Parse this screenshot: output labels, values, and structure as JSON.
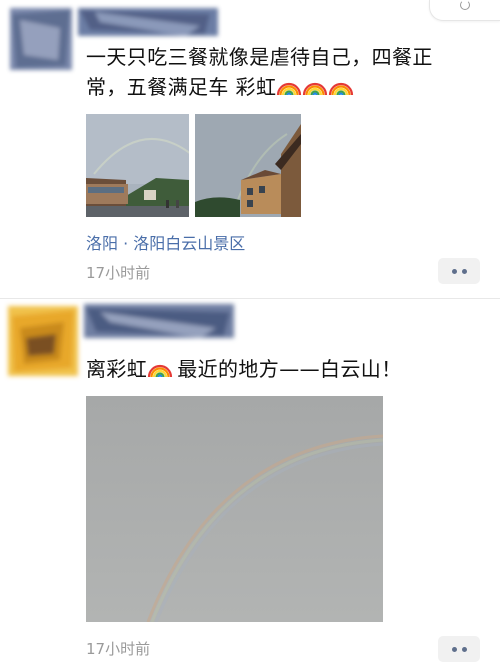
{
  "posts": [
    {
      "text_line1": "一天只吃三餐就像是虐待自己，四餐正",
      "text_line2": "常，五餐满足车 彩虹",
      "location": "洛阳 · 洛阳白云山景区",
      "time": "17小时前",
      "images": [
        "rainbow-photo-hotel",
        "rainbow-photo-building"
      ]
    },
    {
      "text_before": "离彩虹",
      "text_after": "最近的地方——白云山！",
      "time": "17小时前",
      "images": [
        "rainbow-photo-sky"
      ]
    }
  ],
  "icons": {
    "rainbow": "rainbow-emoji-icon",
    "more": "more-options-icon"
  },
  "colors": {
    "link": "#4a6ea9",
    "timestamp": "#9a9a9a",
    "divider": "#e8e8e8"
  }
}
